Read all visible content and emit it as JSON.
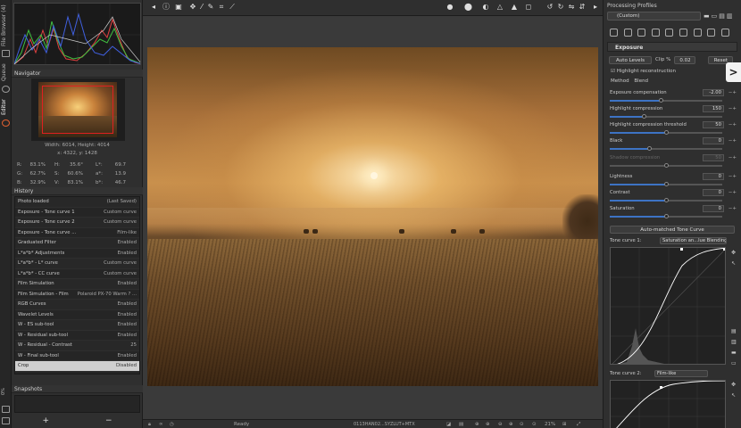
{
  "vertical_tabs": {
    "file_browser": "File Browser (4)",
    "queue": "Queue",
    "editor": "Editor"
  },
  "navigator": {
    "title": "Navigator",
    "dimensions": "Width: 6014, Height: 4014",
    "coords": "x: 4322, y: 1428",
    "pixel_values": [
      {
        "l1": "R:",
        "v1": "83.1%",
        "l2": "H:",
        "v2": "35.6°",
        "l3": "L*:",
        "v3": "69.7"
      },
      {
        "l1": "G:",
        "v1": "62.7%",
        "l2": "S:",
        "v2": "60.6%",
        "l3": "a*:",
        "v3": "13.9"
      },
      {
        "l1": "B:",
        "v1": "32.9%",
        "l2": "V:",
        "v2": "83.1%",
        "l3": "b*:",
        "v3": "46.7"
      }
    ]
  },
  "history": {
    "title": "History",
    "items": [
      {
        "name": "Photo loaded",
        "value": "(Last Saved)"
      },
      {
        "name": "Exposure - Tone curve 1",
        "value": "Custom curve"
      },
      {
        "name": "Exposure - Tone curve 2",
        "value": "Custom curve"
      },
      {
        "name": "Exposure - Tone curve ...",
        "value": "Film-like"
      },
      {
        "name": "Graduated Filter",
        "value": "Enabled"
      },
      {
        "name": "L*a*b* Adjustments",
        "value": "Enabled"
      },
      {
        "name": "L*a*b* - L* curve",
        "value": "Custom curve"
      },
      {
        "name": "L*a*b* - CC curve",
        "value": "Custom curve"
      },
      {
        "name": "Film Simulation",
        "value": "Enabled"
      },
      {
        "name": "Film Simulation - Film",
        "value": "Polaroid PX-70 Warm ? ..."
      },
      {
        "name": "RGB Curves",
        "value": "Enabled"
      },
      {
        "name": "Wavelet Levels",
        "value": "Enabled"
      },
      {
        "name": "W - ES sub-tool",
        "value": "Enabled"
      },
      {
        "name": "W - Residual sub-tool",
        "value": "Enabled"
      },
      {
        "name": "W - Residual - Contrast",
        "value": "25"
      },
      {
        "name": "W - Final sub-tool",
        "value": "Enabled"
      },
      {
        "name": "Crop",
        "value": "Disabled"
      }
    ]
  },
  "snapshots": {
    "title": "Snapshots",
    "add": "+",
    "remove": "−"
  },
  "statusbar": {
    "zoom_left": "0%",
    "status": "Ready",
    "filename": "0113HAN02...SYZLUT+MTX",
    "zoom": "21%"
  },
  "watermark": "",
  "right_panel": {
    "title": "Processing Profiles",
    "profile": "(Custom)",
    "exposure": {
      "title": "Exposure",
      "auto_levels": "Auto Levels",
      "clip_label": "Clip %",
      "clip_value": "0.02",
      "reset": "Reset",
      "highlight_reconstruction": "Highlight reconstruction",
      "method_label": "Method",
      "method_value": "Blend",
      "sliders": [
        {
          "label": "Exposure compensation",
          "value": "-2.00",
          "pos": 0.45,
          "enabled": true
        },
        {
          "label": "Highlight compression",
          "value": "150",
          "pos": 0.3,
          "enabled": true
        },
        {
          "label": "Highlight compression threshold",
          "value": "50",
          "pos": 0.5,
          "enabled": true
        },
        {
          "label": "Black",
          "value": "0",
          "pos": 0.35,
          "enabled": true
        },
        {
          "label": "Shadow compression",
          "value": "50",
          "pos": 0.5,
          "enabled": false
        },
        {
          "label": "Lightness",
          "value": "0",
          "pos": 0.5,
          "enabled": true
        },
        {
          "label": "Contrast",
          "value": "0",
          "pos": 0.5,
          "enabled": true
        },
        {
          "label": "Saturation",
          "value": "0",
          "pos": 0.5,
          "enabled": true
        }
      ],
      "auto_matched": "Auto-matched Tone Curve",
      "tone_curve_1_label": "Tone curve 1:",
      "tone_curve_1_mode": "Saturation an...lue Blending",
      "tone_curve_2_label": "Tone curve 2:",
      "tone_curve_2_mode": "Film-like"
    }
  },
  "colors": {
    "accent": "#3d73c4",
    "nav_rect": "#e02020"
  }
}
